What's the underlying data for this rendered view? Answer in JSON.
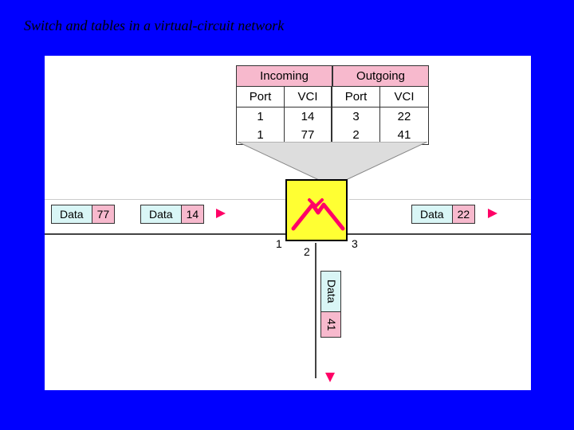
{
  "title": "Switch and tables in a virtual-circuit network",
  "table": {
    "group_in": "Incoming",
    "group_out": "Outgoing",
    "col_port": "Port",
    "col_vci": "VCI",
    "rows": [
      {
        "in_port": "1",
        "in_vci": "14",
        "out_port": "3",
        "out_vci": "22"
      },
      {
        "in_port": "1",
        "in_vci": "77",
        "out_port": "2",
        "out_vci": "41"
      }
    ]
  },
  "ports": {
    "left": "1",
    "bottom": "2",
    "right": "3"
  },
  "packets": {
    "left_outer": {
      "data": "Data",
      "vci": "77"
    },
    "left_inner": {
      "data": "Data",
      "vci": "14"
    },
    "right": {
      "data": "Data",
      "vci": "22"
    },
    "down": {
      "data": "Data",
      "vci": "41"
    }
  }
}
